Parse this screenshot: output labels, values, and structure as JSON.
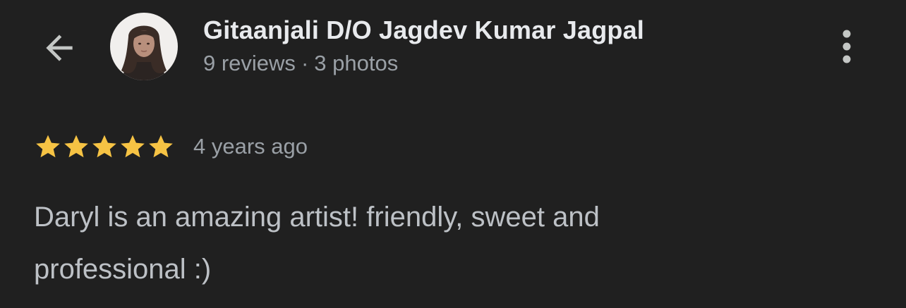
{
  "header": {
    "back_icon": "arrow-left-icon",
    "avatar_icon": "user-avatar-photo",
    "author_name": "Gitaanjali D/O Jagdev Kumar Jagpal",
    "reviews_count": "9 reviews",
    "meta_separator": "·",
    "photos_count": "3 photos",
    "more_icon": "more-vertical-icon"
  },
  "review": {
    "rating": 5,
    "rating_max": 5,
    "star_icon": "star-icon",
    "time_ago": "4 years ago",
    "text": "Daryl is an amazing artist! friendly, sweet and professional :)"
  },
  "colors": {
    "background": "#202020",
    "primary_text": "#e8eaed",
    "secondary_text": "#9aa0a6",
    "body_text": "#bdc1c6",
    "star": "#f6c344"
  }
}
